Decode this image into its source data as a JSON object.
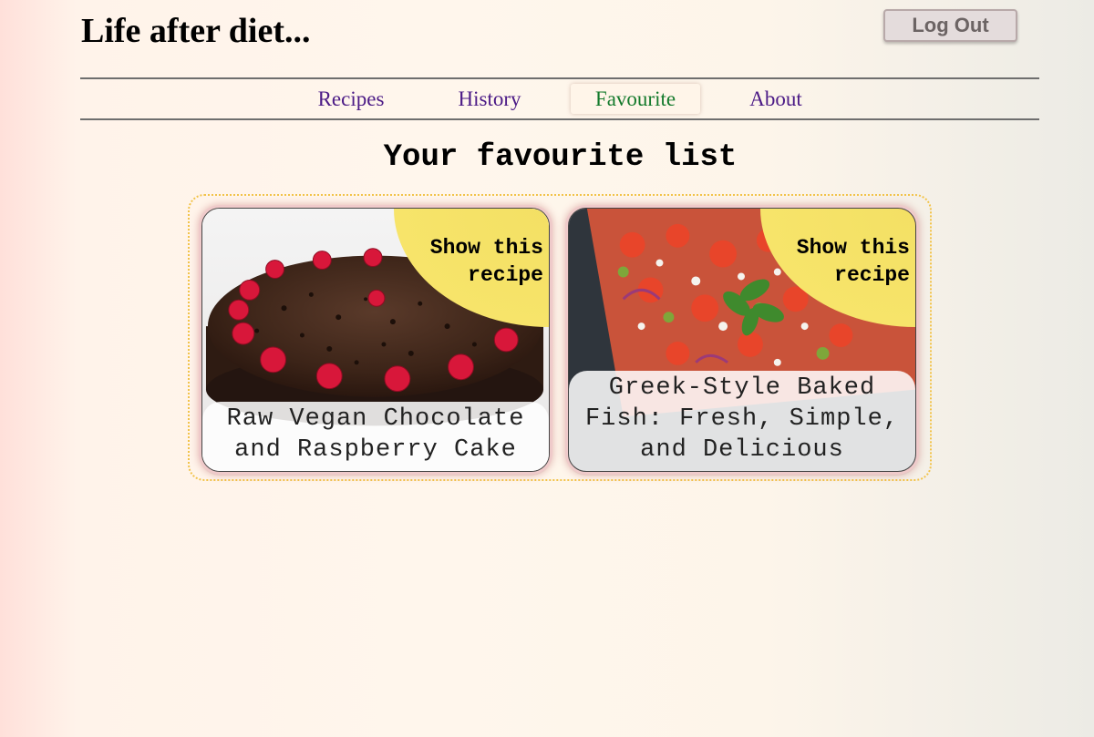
{
  "header": {
    "title": "Life after diet...",
    "logout_label": "Log Out"
  },
  "nav": {
    "items": [
      {
        "label": "Recipes"
      },
      {
        "label": "History"
      },
      {
        "label": "Favourite",
        "active": true
      },
      {
        "label": "About"
      }
    ]
  },
  "main": {
    "heading": "Your favourite list",
    "favourites": [
      {
        "title": "Raw Vegan Chocolate and Raspberry Cake",
        "show_label": "Show this recipe",
        "image": "chocolate-raspberry-cake-photo"
      },
      {
        "title": "Greek-Style Baked Fish: Fresh, Simple, and Delicious",
        "show_label": "Show this recipe",
        "image": "greek-baked-fish-salad-photo"
      }
    ]
  },
  "colors": {
    "nav_link": "#4b1a86",
    "nav_active": "#147a2c",
    "corner_yellow": "#f7e46a",
    "list_border": "#f2c34a"
  }
}
